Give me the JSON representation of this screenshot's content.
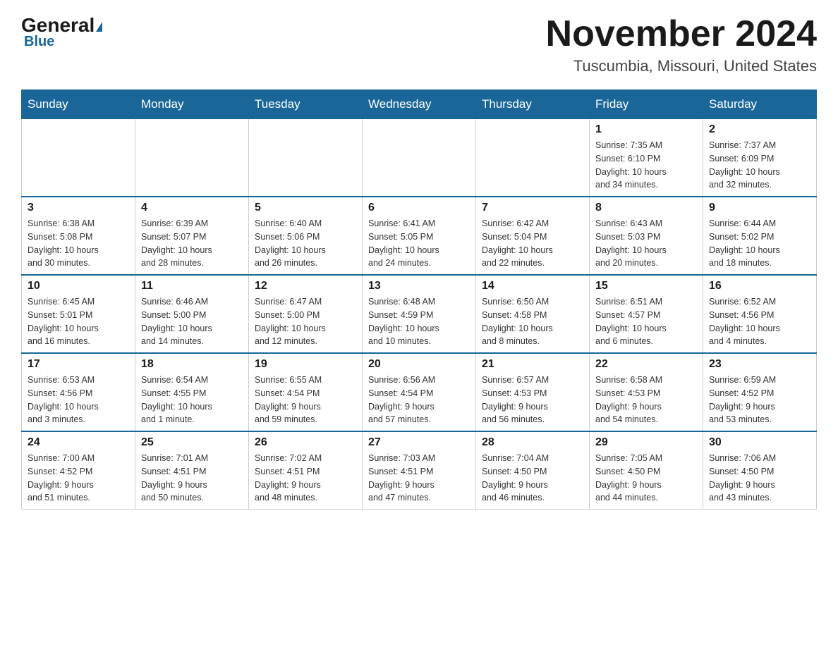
{
  "logo": {
    "general": "General",
    "triangle": "▶",
    "blue": "Blue"
  },
  "header": {
    "month_year": "November 2024",
    "location": "Tuscumbia, Missouri, United States"
  },
  "days_of_week": [
    "Sunday",
    "Monday",
    "Tuesday",
    "Wednesday",
    "Thursday",
    "Friday",
    "Saturday"
  ],
  "weeks": [
    [
      {
        "day": "",
        "info": ""
      },
      {
        "day": "",
        "info": ""
      },
      {
        "day": "",
        "info": ""
      },
      {
        "day": "",
        "info": ""
      },
      {
        "day": "",
        "info": ""
      },
      {
        "day": "1",
        "info": "Sunrise: 7:35 AM\nSunset: 6:10 PM\nDaylight: 10 hours\nand 34 minutes."
      },
      {
        "day": "2",
        "info": "Sunrise: 7:37 AM\nSunset: 6:09 PM\nDaylight: 10 hours\nand 32 minutes."
      }
    ],
    [
      {
        "day": "3",
        "info": "Sunrise: 6:38 AM\nSunset: 5:08 PM\nDaylight: 10 hours\nand 30 minutes."
      },
      {
        "day": "4",
        "info": "Sunrise: 6:39 AM\nSunset: 5:07 PM\nDaylight: 10 hours\nand 28 minutes."
      },
      {
        "day": "5",
        "info": "Sunrise: 6:40 AM\nSunset: 5:06 PM\nDaylight: 10 hours\nand 26 minutes."
      },
      {
        "day": "6",
        "info": "Sunrise: 6:41 AM\nSunset: 5:05 PM\nDaylight: 10 hours\nand 24 minutes."
      },
      {
        "day": "7",
        "info": "Sunrise: 6:42 AM\nSunset: 5:04 PM\nDaylight: 10 hours\nand 22 minutes."
      },
      {
        "day": "8",
        "info": "Sunrise: 6:43 AM\nSunset: 5:03 PM\nDaylight: 10 hours\nand 20 minutes."
      },
      {
        "day": "9",
        "info": "Sunrise: 6:44 AM\nSunset: 5:02 PM\nDaylight: 10 hours\nand 18 minutes."
      }
    ],
    [
      {
        "day": "10",
        "info": "Sunrise: 6:45 AM\nSunset: 5:01 PM\nDaylight: 10 hours\nand 16 minutes."
      },
      {
        "day": "11",
        "info": "Sunrise: 6:46 AM\nSunset: 5:00 PM\nDaylight: 10 hours\nand 14 minutes."
      },
      {
        "day": "12",
        "info": "Sunrise: 6:47 AM\nSunset: 5:00 PM\nDaylight: 10 hours\nand 12 minutes."
      },
      {
        "day": "13",
        "info": "Sunrise: 6:48 AM\nSunset: 4:59 PM\nDaylight: 10 hours\nand 10 minutes."
      },
      {
        "day": "14",
        "info": "Sunrise: 6:50 AM\nSunset: 4:58 PM\nDaylight: 10 hours\nand 8 minutes."
      },
      {
        "day": "15",
        "info": "Sunrise: 6:51 AM\nSunset: 4:57 PM\nDaylight: 10 hours\nand 6 minutes."
      },
      {
        "day": "16",
        "info": "Sunrise: 6:52 AM\nSunset: 4:56 PM\nDaylight: 10 hours\nand 4 minutes."
      }
    ],
    [
      {
        "day": "17",
        "info": "Sunrise: 6:53 AM\nSunset: 4:56 PM\nDaylight: 10 hours\nand 3 minutes."
      },
      {
        "day": "18",
        "info": "Sunrise: 6:54 AM\nSunset: 4:55 PM\nDaylight: 10 hours\nand 1 minute."
      },
      {
        "day": "19",
        "info": "Sunrise: 6:55 AM\nSunset: 4:54 PM\nDaylight: 9 hours\nand 59 minutes."
      },
      {
        "day": "20",
        "info": "Sunrise: 6:56 AM\nSunset: 4:54 PM\nDaylight: 9 hours\nand 57 minutes."
      },
      {
        "day": "21",
        "info": "Sunrise: 6:57 AM\nSunset: 4:53 PM\nDaylight: 9 hours\nand 56 minutes."
      },
      {
        "day": "22",
        "info": "Sunrise: 6:58 AM\nSunset: 4:53 PM\nDaylight: 9 hours\nand 54 minutes."
      },
      {
        "day": "23",
        "info": "Sunrise: 6:59 AM\nSunset: 4:52 PM\nDaylight: 9 hours\nand 53 minutes."
      }
    ],
    [
      {
        "day": "24",
        "info": "Sunrise: 7:00 AM\nSunset: 4:52 PM\nDaylight: 9 hours\nand 51 minutes."
      },
      {
        "day": "25",
        "info": "Sunrise: 7:01 AM\nSunset: 4:51 PM\nDaylight: 9 hours\nand 50 minutes."
      },
      {
        "day": "26",
        "info": "Sunrise: 7:02 AM\nSunset: 4:51 PM\nDaylight: 9 hours\nand 48 minutes."
      },
      {
        "day": "27",
        "info": "Sunrise: 7:03 AM\nSunset: 4:51 PM\nDaylight: 9 hours\nand 47 minutes."
      },
      {
        "day": "28",
        "info": "Sunrise: 7:04 AM\nSunset: 4:50 PM\nDaylight: 9 hours\nand 46 minutes."
      },
      {
        "day": "29",
        "info": "Sunrise: 7:05 AM\nSunset: 4:50 PM\nDaylight: 9 hours\nand 44 minutes."
      },
      {
        "day": "30",
        "info": "Sunrise: 7:06 AM\nSunset: 4:50 PM\nDaylight: 9 hours\nand 43 minutes."
      }
    ]
  ]
}
